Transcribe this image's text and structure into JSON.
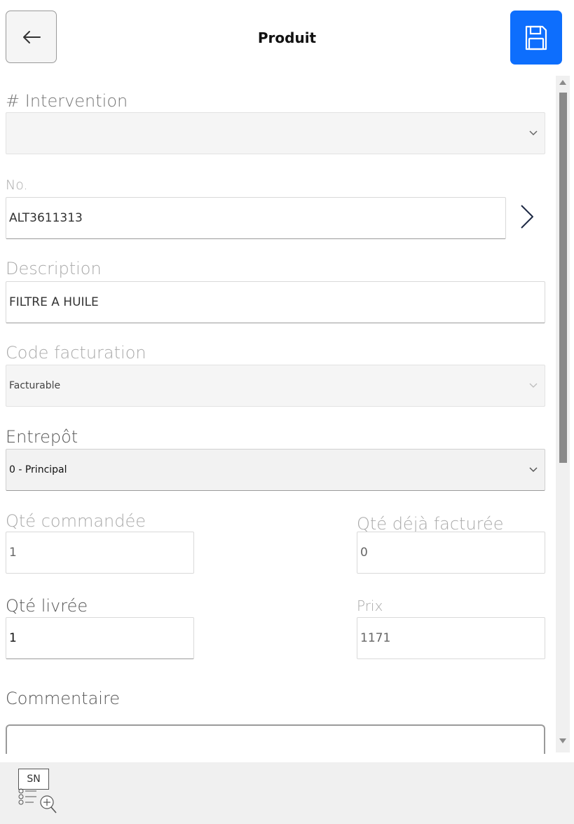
{
  "header": {
    "title": "Produit",
    "back_icon": "arrow-left-icon",
    "save_icon": "floppy-disk-icon",
    "accent": "#0d6efd"
  },
  "form": {
    "intervention": {
      "label": "# Intervention",
      "value": ""
    },
    "no": {
      "label": "No.",
      "value": "ALT3611313"
    },
    "description": {
      "label": "Description",
      "value": "FILTRE A HUILE"
    },
    "code_facturation": {
      "label": "Code facturation",
      "value": "Facturable"
    },
    "entrepot": {
      "label": "Entrepôt",
      "value": "0 - Principal"
    },
    "qte_commandee": {
      "label": "Qté commandée",
      "value": "1"
    },
    "qte_facturee": {
      "label": "Qté déjà facturée",
      "value": "0"
    },
    "qte_livree": {
      "label": "Qté livrée",
      "value": "1"
    },
    "prix": {
      "label": "Prix",
      "value": "1171"
    },
    "commentaire": {
      "label": "Commentaire",
      "value": ""
    }
  },
  "footer": {
    "serial_button_text": "SN",
    "serial_icon": "serial-number-search-icon"
  }
}
